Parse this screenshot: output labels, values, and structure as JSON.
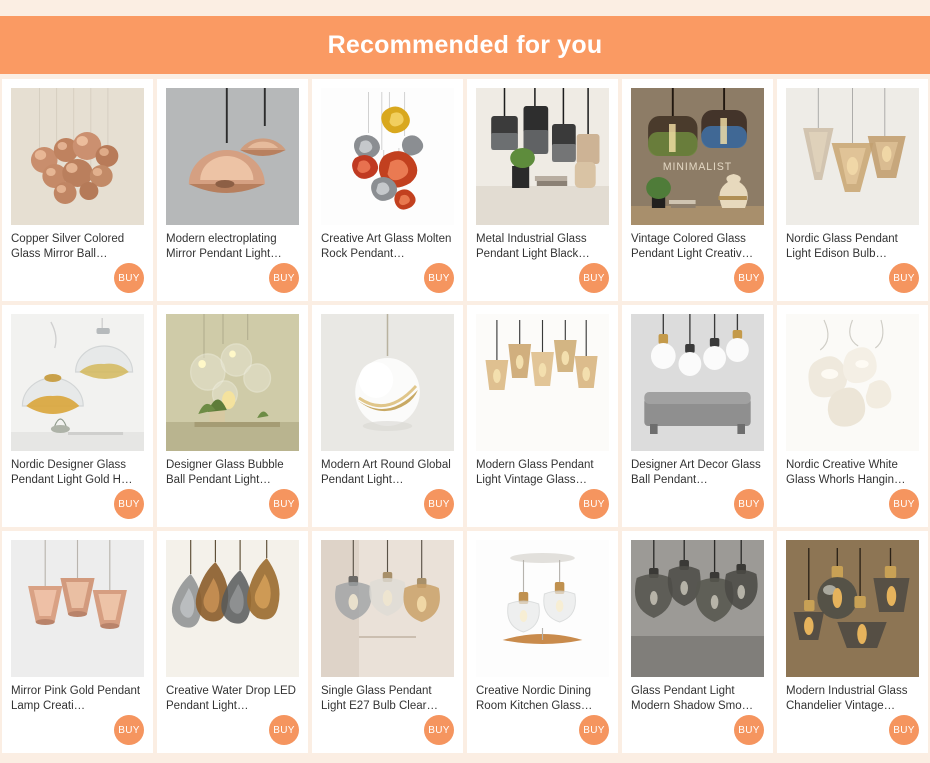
{
  "header": {
    "title": "Recommended for you",
    "band_color": "#fa9a63",
    "background_color": "#fbeee3",
    "title_color": "#ffffff"
  },
  "buy_button": {
    "label": "BUY",
    "color": "#f5955f",
    "text_color": "#ffffff"
  },
  "products": [
    {
      "title": "Copper Silver Colored Glass Mirror Ball…",
      "buy_label": "BUY",
      "image": "copper-silver-mirror-balls-cluster",
      "image_bg": "#e4ddd0"
    },
    {
      "title": "Modern electroplating Mirror Pendant Light…",
      "buy_label": "BUY",
      "image": "rose-gold-dome-mirror-pendants",
      "image_bg": "#b5b7b8"
    },
    {
      "title": "Creative Art Glass Molten Rock Pendant…",
      "buy_label": "BUY",
      "image": "molten-rock-gold-red-silver-cluster",
      "image_bg": "#ffffff"
    },
    {
      "title": "Metal Industrial Glass Pendant Light Black…",
      "buy_label": "BUY",
      "image": "black-smoke-glass-cylinders-over-shelf",
      "image_bg": "#efece6"
    },
    {
      "title": "Vintage Colored Glass Pendant Light Creativ…",
      "buy_label": "BUY",
      "image": "colored-glass-drums-minimalist-room",
      "image_overlay_text": "MINIMALIST",
      "image_bg": "#8a7864"
    },
    {
      "title": "Nordic Glass Pendant Light Edison Bulb…",
      "buy_label": "BUY",
      "image": "amber-smoke-glass-cones-trio",
      "image_bg": "#efeeea"
    },
    {
      "title": "Nordic Designer Glass Pendant Light Gold H…",
      "buy_label": "BUY",
      "image": "clear-dome-glass-with-gold-crystals",
      "image_bg": "#f2f2f0"
    },
    {
      "title": "Designer Glass Bubble Ball Pendant Light…",
      "buy_label": "BUY",
      "image": "clear-bubble-balls-over-plant",
      "image_bg": "#cdc9a6"
    },
    {
      "title": "Modern Art Round Global Pendant Light…",
      "buy_label": "BUY",
      "image": "white-sphere-with-gold-ring",
      "image_bg": "#e8e7e3"
    },
    {
      "title": "Modern Glass Pendant Light Vintage Glass…",
      "buy_label": "BUY",
      "image": "amber-glass-pendant-row-five",
      "image_bg": "#fbfaf8"
    },
    {
      "title": "Designer Art Decor Glass Ball Pendant…",
      "buy_label": "BUY",
      "image": "white-glass-balls-over-gray-sofa",
      "image_bg": "#d8d8d8"
    },
    {
      "title": "Nordic Creative White Glass Whorls Hangin…",
      "buy_label": "BUY",
      "image": "white-whorl-organic-pendants",
      "image_bg": "#faf9f6"
    },
    {
      "title": "Mirror Pink Gold Pendant Lamp Creati…",
      "buy_label": "BUY",
      "image": "pink-gold-mirror-cone-trio",
      "image_bg": "#ededed"
    },
    {
      "title": "Creative Water Drop LED Pendant Light…",
      "buy_label": "BUY",
      "image": "amber-water-drop-teardrops",
      "image_bg": "#f4f1ec"
    },
    {
      "title": "Single Glass Pendant Light E27 Bulb Clear…",
      "buy_label": "BUY",
      "image": "smoke-clear-amber-bell-trio",
      "image_bg": "#e9e0d8"
    },
    {
      "title": "Creative Nordic Dining Room Kitchen Glass…",
      "buy_label": "BUY",
      "image": "clear-glass-wood-pendant-pair",
      "image_bg": "#ffffff"
    },
    {
      "title": "Glass Pendant Light Modern Shadow Smo…",
      "buy_label": "BUY",
      "image": "smoke-gray-glass-shades-concrete",
      "image_bg": "#9a9894"
    },
    {
      "title": "Modern Industrial Glass Chandelier Vintage…",
      "buy_label": "BUY",
      "image": "amber-industrial-glass-chandelier-four",
      "image_bg": "#8d7657"
    }
  ]
}
